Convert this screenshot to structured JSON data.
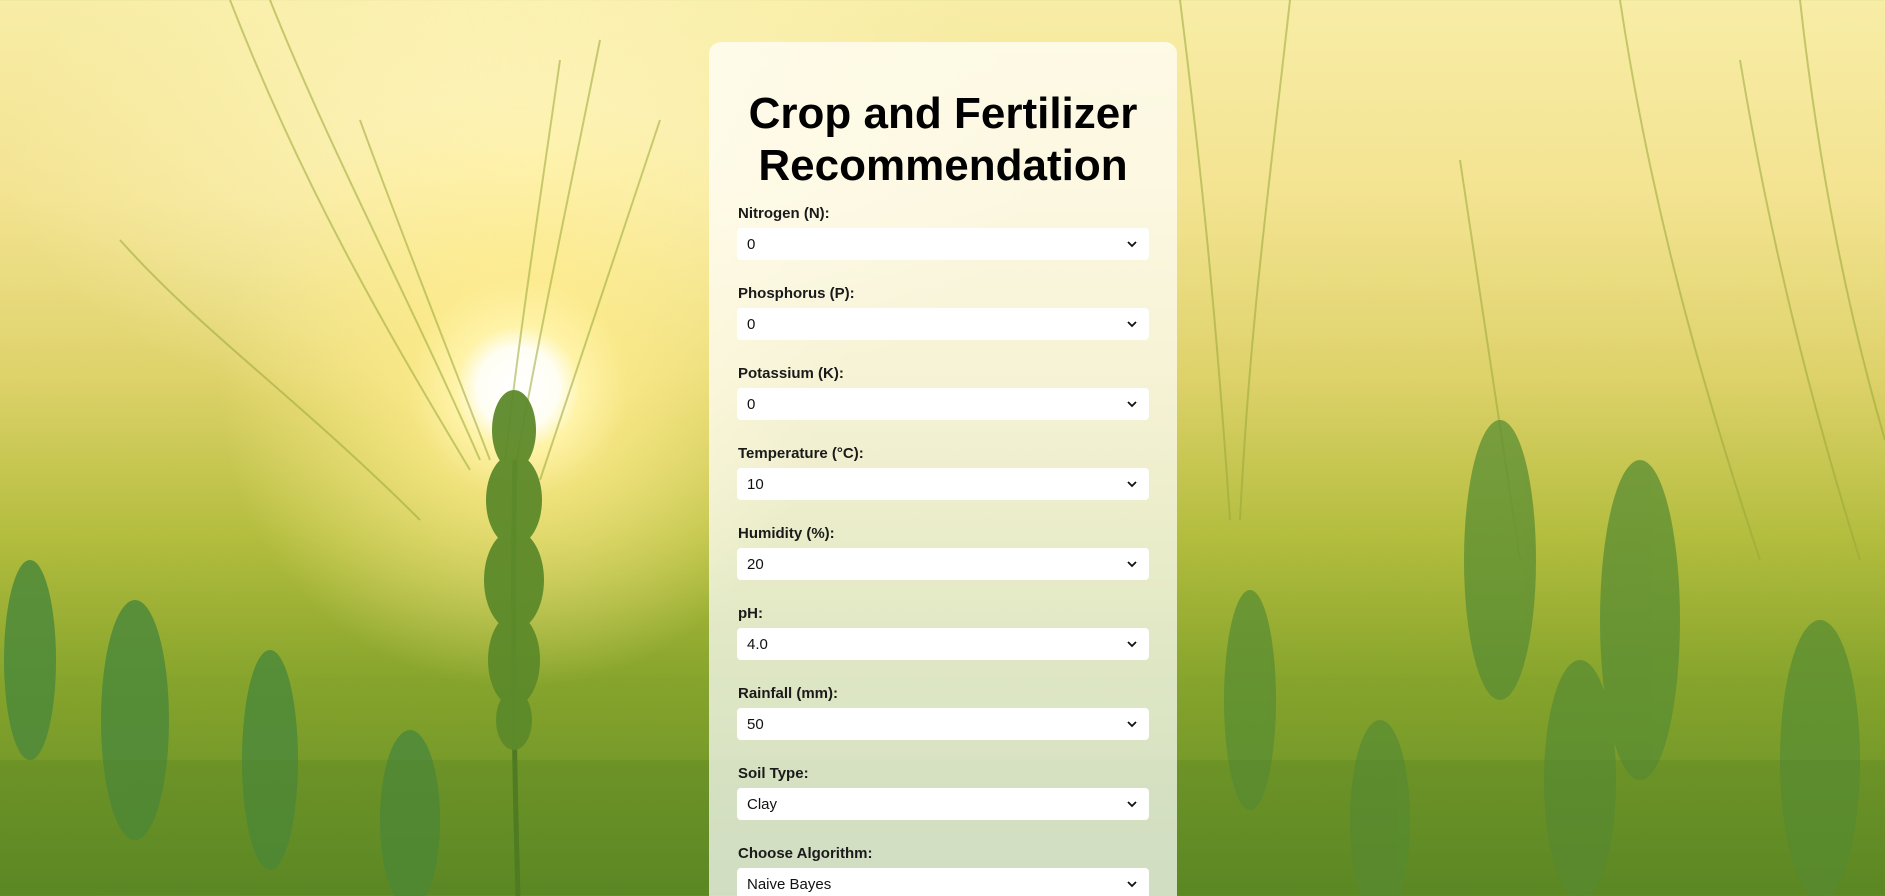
{
  "page": {
    "title": "Crop and Fertilizer Recommendation"
  },
  "form": {
    "fields": [
      {
        "label": "Nitrogen (N):",
        "value": "0"
      },
      {
        "label": "Phosphorus (P):",
        "value": "0"
      },
      {
        "label": "Potassium (K):",
        "value": "0"
      },
      {
        "label": "Temperature (°C):",
        "value": "10"
      },
      {
        "label": "Humidity (%):",
        "value": "20"
      },
      {
        "label": "pH:",
        "value": "4.0"
      },
      {
        "label": "Rainfall (mm):",
        "value": "50"
      },
      {
        "label": "Soil Type:",
        "value": "Clay"
      },
      {
        "label": "Choose Algorithm:",
        "value": "Naive Bayes"
      }
    ]
  },
  "colors": {
    "sky": "#f8eda6",
    "sun": "#ffffff",
    "grass": "#5f8a24",
    "card": "#ffffff"
  },
  "icons": {
    "select_arrow": "chevron-down-icon"
  }
}
